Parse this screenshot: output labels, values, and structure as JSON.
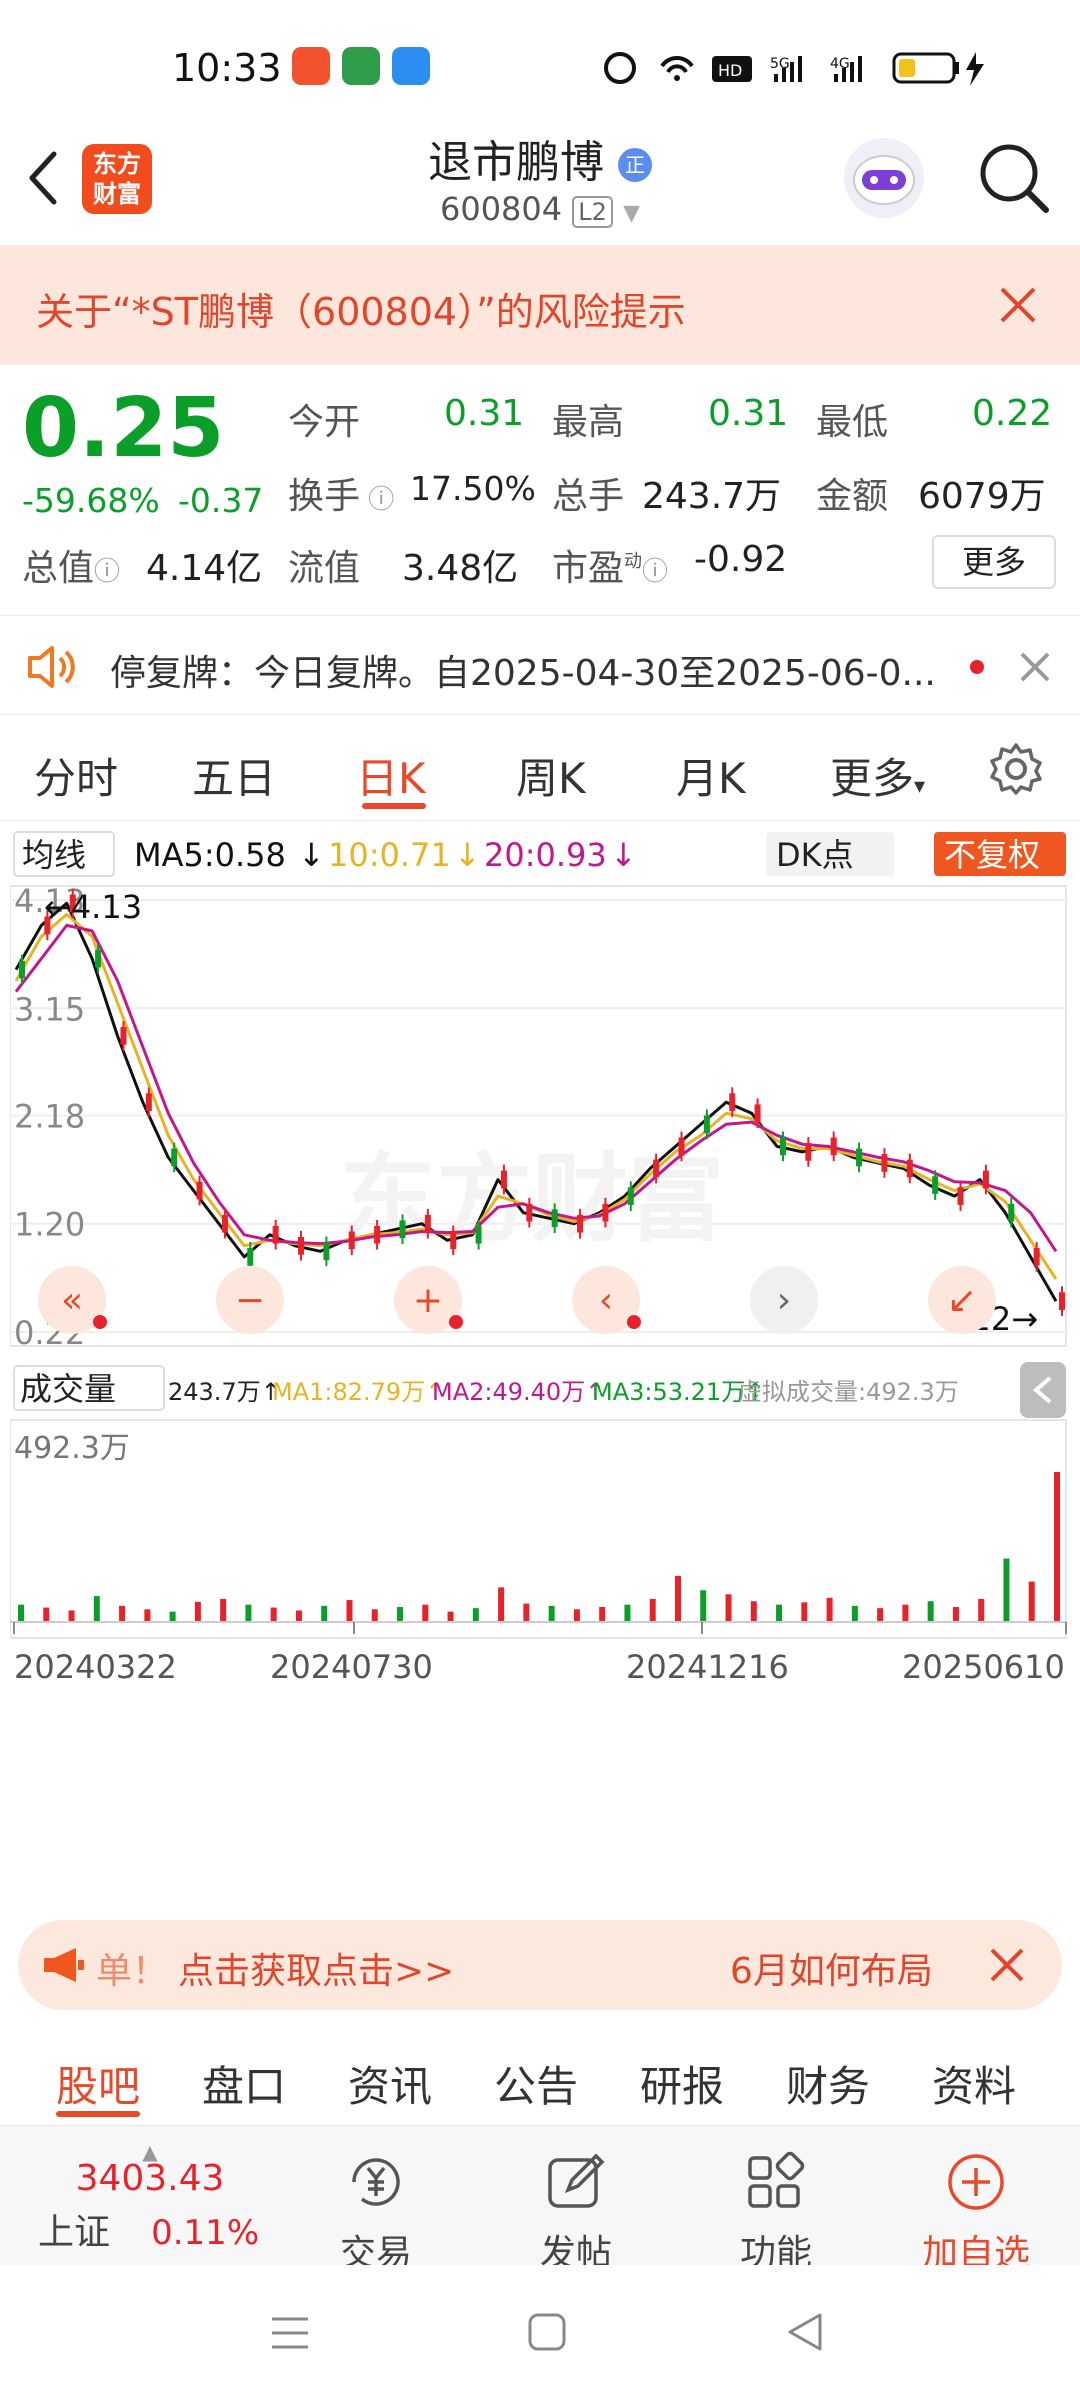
{
  "status": {
    "time": "10:33",
    "net_hd": "HD",
    "sig1": "5G",
    "sig2": "4G"
  },
  "header": {
    "logo_line1": "东方",
    "logo_line2": "财富",
    "stock_name": "退市鹏博",
    "badge": "正",
    "code": "600804",
    "level": "L2"
  },
  "risk_banner": {
    "text": "关于“*ST鹏博（600804）”的风险提示"
  },
  "quote": {
    "price": "0.25",
    "change_pct": "-59.68%",
    "change": "-0.37",
    "open_label": "今开",
    "open": "0.31",
    "high_label": "最高",
    "high": "0.31",
    "low_label": "最低",
    "low": "0.22",
    "turnover_label": "换手",
    "turnover": "17.50%",
    "volume_label": "总手",
    "volume": "243.7万",
    "amount_label": "金额",
    "amount": "6079万",
    "mktcap_label": "总值",
    "mktcap": "4.14亿",
    "float_label": "流值",
    "float": "3.48亿",
    "pe_label": "市盈",
    "pe_sup": "动",
    "pe": "-0.92",
    "more_label": "更多"
  },
  "notice": {
    "text": "停复牌：今日复牌。自2025-04-30至2025-06-0..."
  },
  "chart_tabs": [
    "分时",
    "五日",
    "日K",
    "周K",
    "月K",
    "更多"
  ],
  "chart_tab_active": 2,
  "indicator": {
    "ma_label": "均线",
    "ma5": "MA5:0.58",
    "ma10": "10:0.71",
    "ma20": "20:0.93",
    "dk_label": "DK点",
    "adjust_label": "不复权",
    "colors": {
      "ma5": "#111111",
      "ma10": "#e6b422",
      "ma20": "#c2188f",
      "up": "#e8222a",
      "down": "#0b9f2a"
    }
  },
  "volume_bar": {
    "label": "成交量",
    "vol": "243.7万",
    "ma1": "MA1:82.79万",
    "ma2": "MA2:49.40万",
    "ma3": "MA3:53.21万",
    "virtual": "虚拟成交量:492.3万",
    "max_label": "492.3万"
  },
  "chart_data": {
    "type": "line",
    "y_ticks": [
      "4.13",
      "3.15",
      "2.18",
      "1.20",
      "0.22"
    ],
    "ylim": [
      0.22,
      4.13
    ],
    "x_labels": [
      "20240322",
      "20240730",
      "20241216",
      "20250610"
    ],
    "annotations": [
      "4.13",
      "0.22"
    ],
    "series": [
      {
        "name": "MA5",
        "values": [
          3.5,
          3.9,
          4.1,
          3.6,
          2.9,
          2.3,
          1.8,
          1.5,
          1.2,
          0.9,
          1.1,
          1.0,
          0.95,
          1.05,
          1.1,
          1.15,
          1.2,
          1.05,
          1.1,
          1.6,
          1.3,
          1.25,
          1.2,
          1.3,
          1.45,
          1.7,
          1.9,
          2.1,
          2.3,
          2.2,
          1.9,
          1.85,
          1.9,
          1.8,
          1.75,
          1.7,
          1.55,
          1.45,
          1.6,
          1.3,
          0.9,
          0.5
        ]
      },
      {
        "name": "MA10",
        "values": [
          3.4,
          3.8,
          4.0,
          3.8,
          3.2,
          2.6,
          2.0,
          1.6,
          1.3,
          1.0,
          1.05,
          1.02,
          1.0,
          1.05,
          1.1,
          1.12,
          1.15,
          1.1,
          1.12,
          1.45,
          1.38,
          1.28,
          1.22,
          1.28,
          1.42,
          1.65,
          1.85,
          2.0,
          2.2,
          2.15,
          1.95,
          1.88,
          1.88,
          1.82,
          1.76,
          1.72,
          1.6,
          1.5,
          1.56,
          1.4,
          1.05,
          0.7
        ]
      },
      {
        "name": "MA20",
        "values": [
          3.3,
          3.6,
          3.9,
          3.85,
          3.4,
          2.8,
          2.2,
          1.75,
          1.4,
          1.1,
          1.05,
          1.03,
          1.02,
          1.04,
          1.08,
          1.1,
          1.13,
          1.12,
          1.13,
          1.35,
          1.38,
          1.3,
          1.25,
          1.27,
          1.38,
          1.58,
          1.78,
          1.95,
          2.1,
          2.12,
          2.0,
          1.92,
          1.9,
          1.85,
          1.8,
          1.76,
          1.68,
          1.58,
          1.57,
          1.5,
          1.3,
          0.95
        ]
      }
    ],
    "volume": [
      30,
      25,
      20,
      45,
      28,
      22,
      18,
      35,
      40,
      30,
      25,
      20,
      28,
      38,
      22,
      26,
      30,
      18,
      24,
      60,
      32,
      28,
      22,
      26,
      30,
      40,
      80,
      55,
      48,
      36,
      30,
      34,
      42,
      28,
      24,
      30,
      36,
      26,
      40,
      110,
      70,
      260
    ]
  },
  "chart_controls": [
    "«",
    "−",
    "+",
    "‹",
    "›",
    "↙"
  ],
  "ad": {
    "left": "单！",
    "cta": "点击获取点击>>",
    "right": "6月如何布局"
  },
  "bottom_tabs": [
    "股吧",
    "盘口",
    "资讯",
    "公告",
    "研报",
    "财务",
    "资料"
  ],
  "bottom_tab_active": 0,
  "toolbar": {
    "index_value": "3403.43",
    "index_name": "上证",
    "index_change": "0.11%",
    "trade": "交易",
    "post": "发帖",
    "func": "功能",
    "add": "加自选"
  }
}
